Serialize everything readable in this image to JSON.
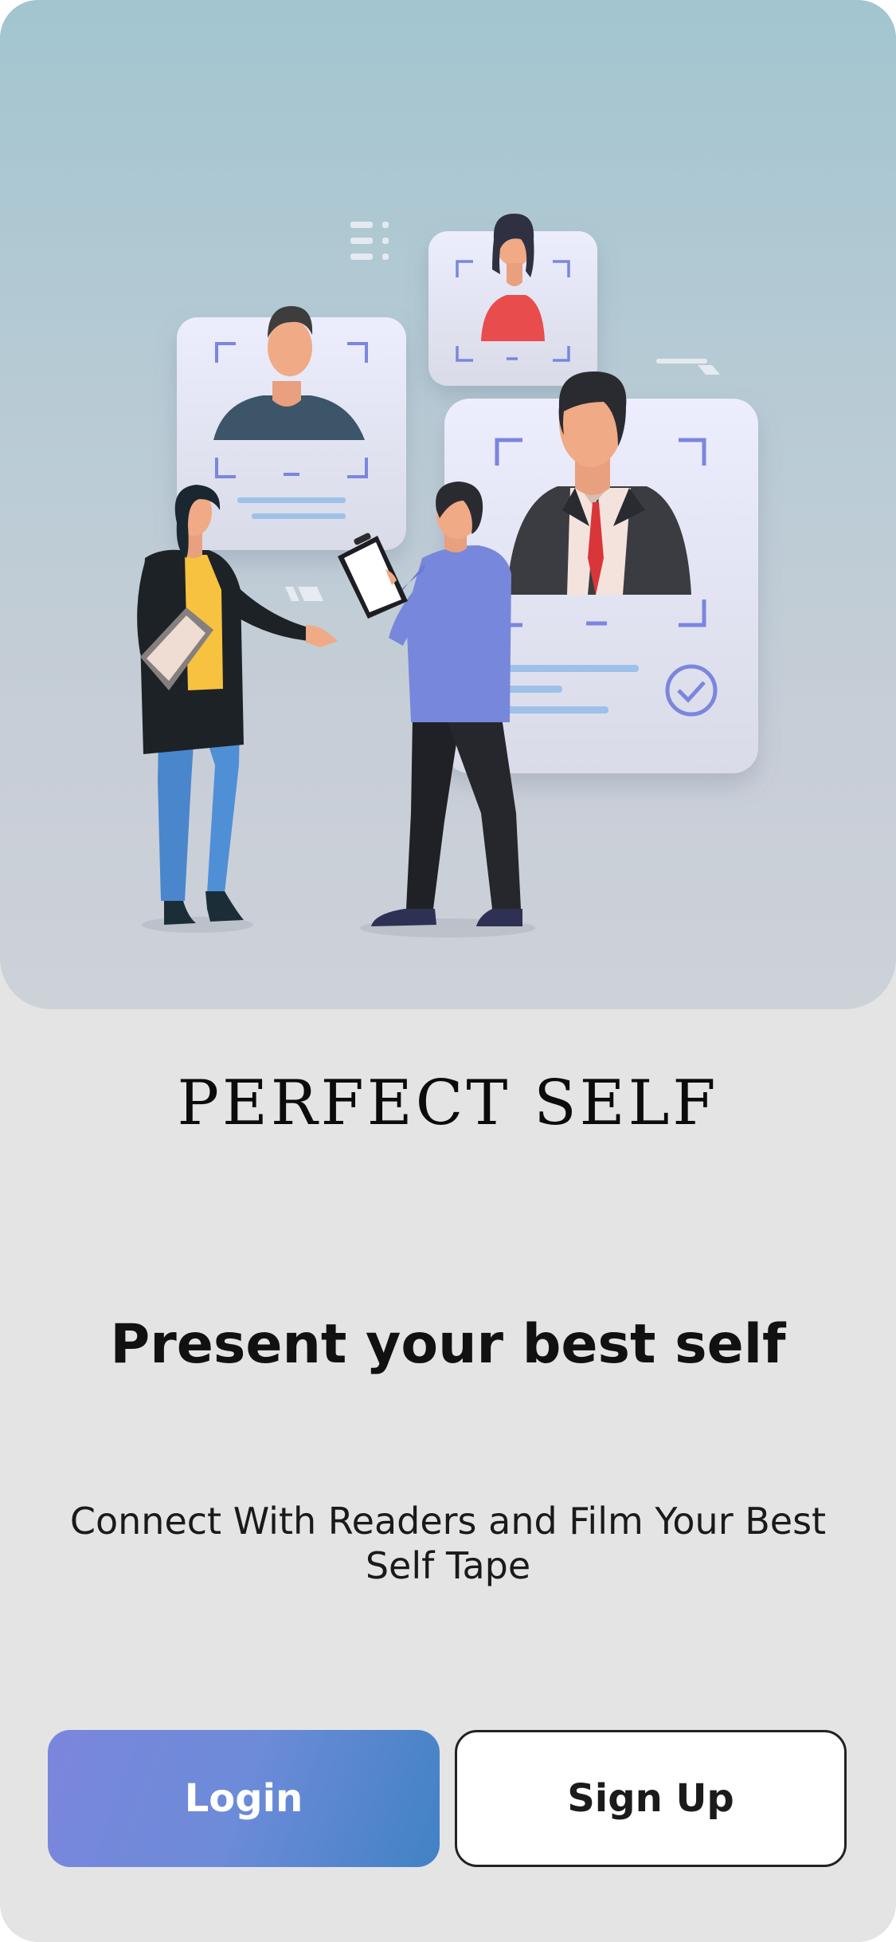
{
  "hero": {
    "illustration": "casting-illustration",
    "colors": {
      "card": "#eceefc",
      "frame": "#7b86dd",
      "accent_line": "#9ec1ea",
      "jacket_blue": "#7787db",
      "dark": "#222327"
    }
  },
  "brand": {
    "title": "PERFECT SELF"
  },
  "headline": "Present your best self",
  "subline": "Connect With Readers and Film Your Best Self Tape",
  "actions": {
    "login_label": "Login",
    "signup_label": "Sign Up"
  }
}
